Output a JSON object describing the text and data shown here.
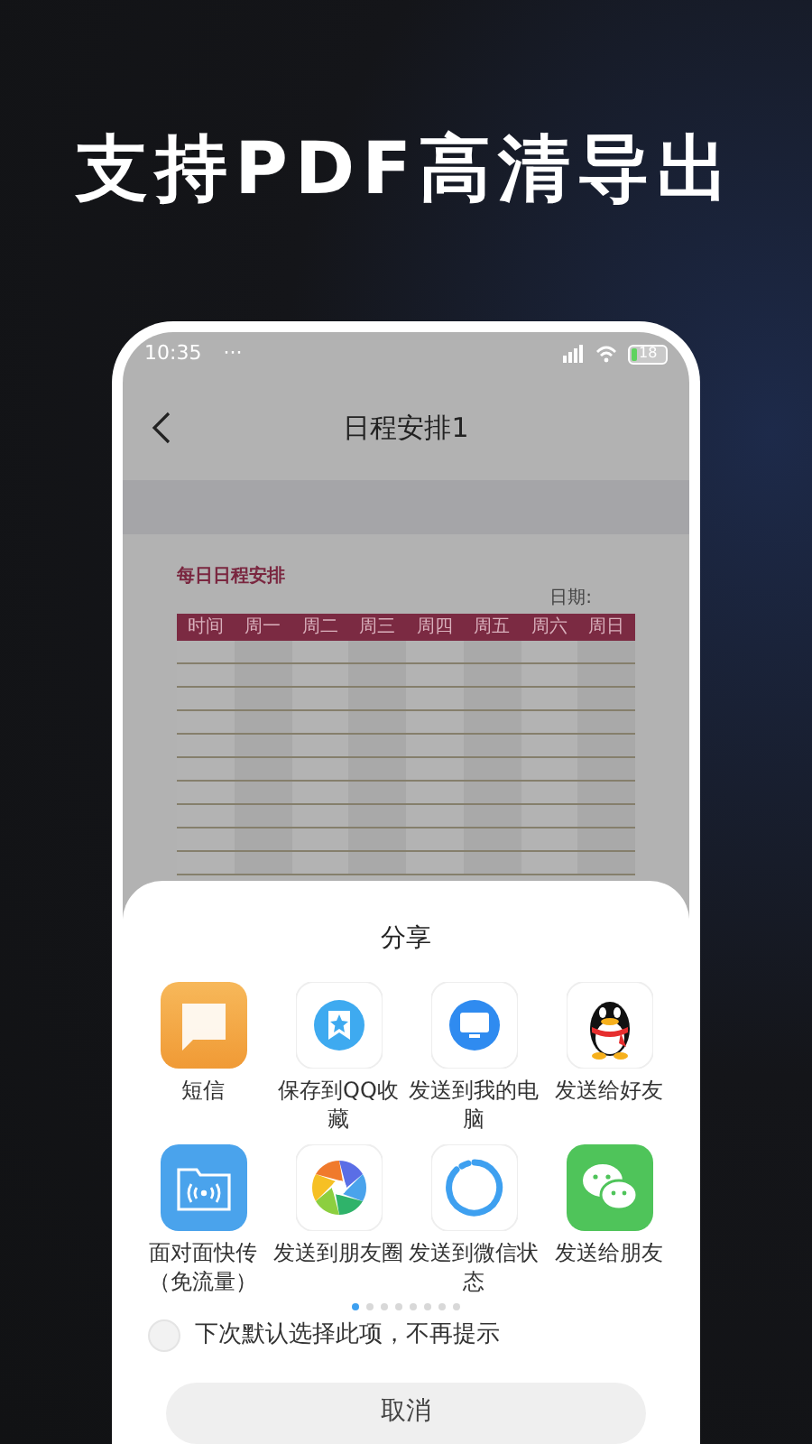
{
  "headline": "支持PDF高清导出",
  "status_bar": {
    "time": "10:35",
    "dots": "···",
    "battery": "18"
  },
  "nav": {
    "title": "日程安排1"
  },
  "document": {
    "title": "每日日程安排",
    "date_label": "日期:",
    "columns": [
      "时间",
      "周一",
      "周二",
      "周三",
      "周四",
      "周五",
      "周六",
      "周日"
    ]
  },
  "share_sheet": {
    "title": "分享",
    "items": [
      {
        "kind": "sms",
        "label": "短信"
      },
      {
        "kind": "qq_favorites",
        "label": "保存到QQ收藏"
      },
      {
        "kind": "computer",
        "label": "发送到我的电脑"
      },
      {
        "kind": "qq",
        "label": "发送给好友"
      },
      {
        "kind": "face_transfer",
        "label": "面对面快传（免流量）"
      },
      {
        "kind": "moments",
        "label": "发送到朋友圈"
      },
      {
        "kind": "wechat_status",
        "label": "发送到微信状态"
      },
      {
        "kind": "wechat",
        "label": "发送给朋友"
      }
    ],
    "page_dots": [
      {
        "selected": true
      },
      {
        "selected": false
      },
      {
        "selected": false
      },
      {
        "selected": false
      },
      {
        "selected": false
      },
      {
        "selected": false
      },
      {
        "selected": false
      },
      {
        "selected": false
      }
    ],
    "remember": {
      "label": "下次默认选择此项，不再提示",
      "checked": false
    },
    "cancel": "取消"
  }
}
